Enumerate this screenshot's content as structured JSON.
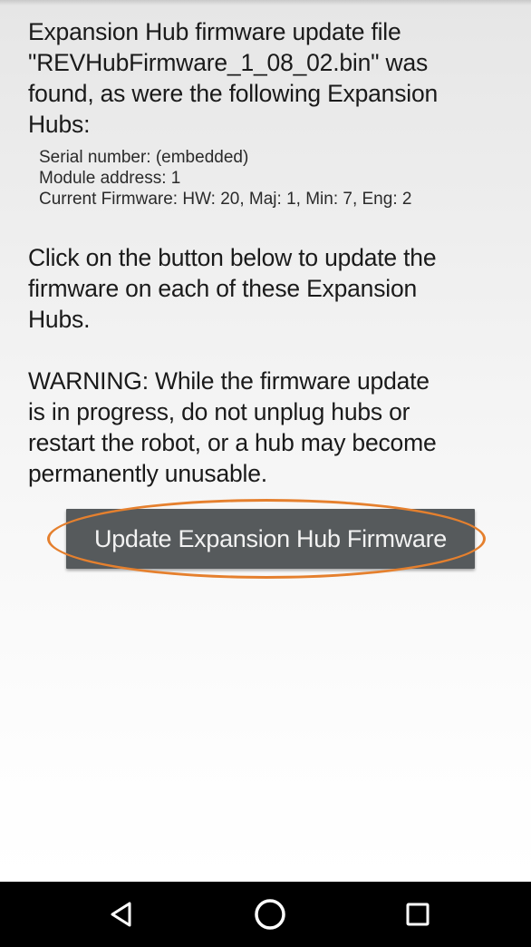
{
  "dialog": {
    "intro_lines": [
      "Expansion Hub firmware update file",
      "\"REVHubFirmware_1_08_02.bin\" was",
      "found, as were the following Expansion",
      "Hubs:"
    ],
    "hub": {
      "serial": "Serial number: (embedded)",
      "address": "Module address: 1",
      "firmware": "Current Firmware: HW: 20, Maj: 1, Min: 7, Eng: 2"
    },
    "instruction_lines": [
      "Click on the button below to update the",
      "firmware on each of these Expansion",
      "Hubs."
    ],
    "warning_lines": [
      "WARNING: While the firmware update",
      "is in progress, do not unplug hubs or",
      "restart the robot, or a hub may become",
      "permanently unusable."
    ],
    "update_button_label": "Update Expansion Hub Firmware"
  },
  "annotation": {
    "highlight_color": "#e5802e"
  },
  "nav_bar": {
    "back_icon": "back-triangle-icon",
    "home_icon": "home-circle-icon",
    "recents_icon": "recents-square-icon"
  }
}
